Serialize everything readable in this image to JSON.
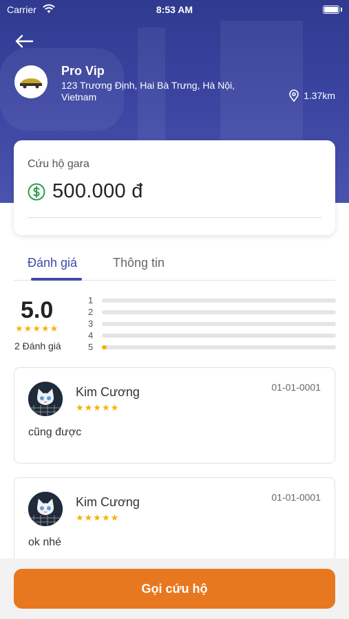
{
  "status_bar": {
    "carrier": "Carrier",
    "time": "8:53 AM"
  },
  "garage": {
    "name": "Pro Vip",
    "address": "123 Trương Định, Hai Bà Trưng, Hà Nội, Vietnam",
    "distance": "1.37km"
  },
  "service": {
    "name": "Cứu hộ gara",
    "price": "500.000 đ"
  },
  "tabs": [
    {
      "label": "Đánh giá",
      "active": true
    },
    {
      "label": "Thông tin",
      "active": false
    }
  ],
  "rating_summary": {
    "average": "5.0",
    "stars": "★★★★★",
    "count_label": "2 Đánh giá",
    "distribution": [
      {
        "label": "1",
        "fraction": 0
      },
      {
        "label": "2",
        "fraction": 0
      },
      {
        "label": "3",
        "fraction": 0
      },
      {
        "label": "4",
        "fraction": 0
      },
      {
        "label": "5",
        "fraction": 0.02
      }
    ]
  },
  "reviews": [
    {
      "name": "Kim Cương",
      "stars": "★★★★★",
      "date": "01-01-0001",
      "text": "cũng được"
    },
    {
      "name": "Kim Cương",
      "stars": "★★★★★",
      "date": "01-01-0001",
      "text": "ok nhé"
    }
  ],
  "cta": {
    "label": "Gọi cứu hộ"
  },
  "colors": {
    "primary": "#3e4aa3",
    "accent": "#e8781f",
    "star": "#f5b301",
    "money": "#2e9e4e"
  },
  "icons": {
    "back": "arrow-left-icon",
    "location": "location-pin-icon",
    "money": "dollar-circle-icon"
  }
}
